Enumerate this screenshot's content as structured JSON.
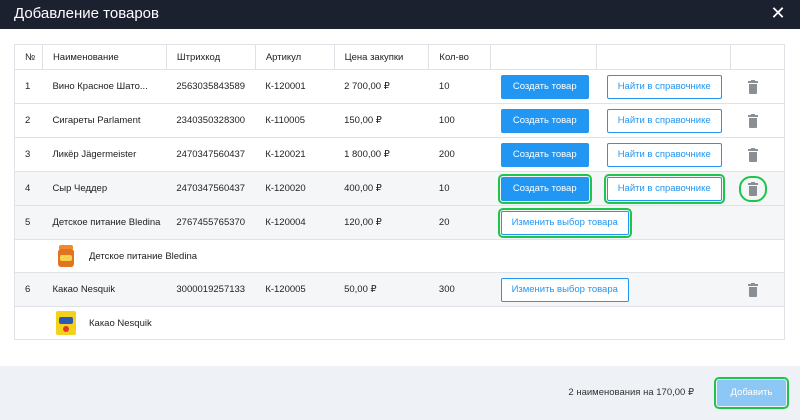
{
  "window": {
    "title": "Добавление товаров",
    "close_icon": "close-icon"
  },
  "table": {
    "headers": [
      "№",
      "Наименование",
      "Штрихкод",
      "Артикул",
      "Цена закупки",
      "Кол-во",
      "",
      "",
      ""
    ],
    "rows": [
      {
        "num": "1",
        "name": "Вино Красное Шато...",
        "barcode": "2563035843589",
        "article": "К-120001",
        "price": "2 700,00 ₽",
        "qty": "10",
        "create_label": "Создать товар",
        "find_label": "Найти в справочнике"
      },
      {
        "num": "2",
        "name": "Сигареты Parlament",
        "barcode": "2340350328300",
        "article": "К-110005",
        "price": "150,00 ₽",
        "qty": "100",
        "create_label": "Создать товар",
        "find_label": "Найти в справочнике"
      },
      {
        "num": "3",
        "name": "Ликёр Jägermeister",
        "barcode": "2470347560437",
        "article": "К-120021",
        "price": "1 800,00 ₽",
        "qty": "200",
        "create_label": "Создать товар",
        "find_label": "Найти в справочнике"
      },
      {
        "num": "4",
        "name": "Сыр Чеддер",
        "barcode": "2470347560437",
        "article": "К-120020",
        "price": "400,00 ₽",
        "qty": "10",
        "create_label": "Создать товар",
        "find_label": "Найти в справочнике"
      },
      {
        "num": "5",
        "name": "Детское питание Bledina",
        "barcode": "2767455765370",
        "article": "К-120004",
        "price": "120,00 ₽",
        "qty": "20",
        "change_label": "Изменить выбор товара",
        "selected_product": "Детское питание Bledina"
      },
      {
        "num": "6",
        "name": "Какао Nesquik",
        "barcode": "3000019257133",
        "article": "К-120005",
        "price": "50,00 ₽",
        "qty": "300",
        "change_label": "Изменить выбор товара",
        "selected_product": "Какао Nesquik"
      }
    ]
  },
  "footer": {
    "summary": "2 наименования на 170,00 ₽",
    "add_label": "Добавить"
  },
  "colors": {
    "titlebar": "#1c2130",
    "primary": "#2196f3",
    "add_disabled": "#8cc7f5",
    "highlight": "#1fc44a"
  }
}
